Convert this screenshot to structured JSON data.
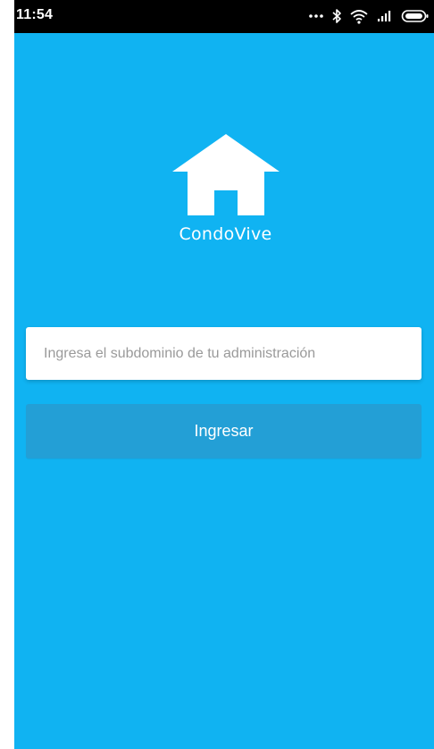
{
  "status_bar": {
    "time": "11:54",
    "icons": [
      "more-dots-icon",
      "bluetooth-icon",
      "wifi-icon",
      "signal-icon",
      "battery-icon"
    ]
  },
  "brand": {
    "name": "CondoVive",
    "logo_icon": "house-icon"
  },
  "form": {
    "subdomain_placeholder": "Ingresa el subdominio de tu administración",
    "subdomain_value": "",
    "submit_label": "Ingresar"
  },
  "colors": {
    "background": "#10b3f2",
    "status_bar": "#000000",
    "button": "#239fd6",
    "input_background": "#ffffff",
    "text_on_accent": "#ffffff"
  }
}
